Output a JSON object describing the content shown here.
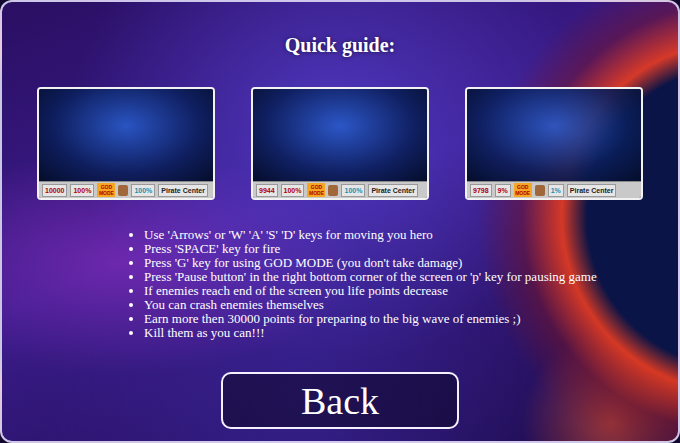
{
  "title": "Quick guide:",
  "screenshots": [
    {
      "score": "10000",
      "health": "100%",
      "badge": "GOD MODE",
      "shield": "100%",
      "location": "Pirate Center"
    },
    {
      "score": "9944",
      "health": "100%",
      "badge": "GOD MODE",
      "shield": "100%",
      "location": "Pirate Center"
    },
    {
      "score": "9798",
      "health": "9%",
      "badge": "GOD MODE",
      "shield": "1%",
      "location": "Pirate Center"
    }
  ],
  "instructions": [
    "Use 'Arrows' or 'W' 'A' 'S' 'D' keys for moving you hero",
    "Press 'SPACE' key for fire",
    "Press 'G' key for using GOD MODE (you don't take damage)",
    "Press 'Pause button' in the right bottom corner of the screen or 'p' key for pausing game",
    "If enemies reach end of the screen you life points decrease",
    "You can crash enemies themselves",
    "Earn more then 30000 points for preparing to the big wave of enemies ;)",
    "Kill them as you can!!!"
  ],
  "buttons": [
    "Back"
  ]
}
